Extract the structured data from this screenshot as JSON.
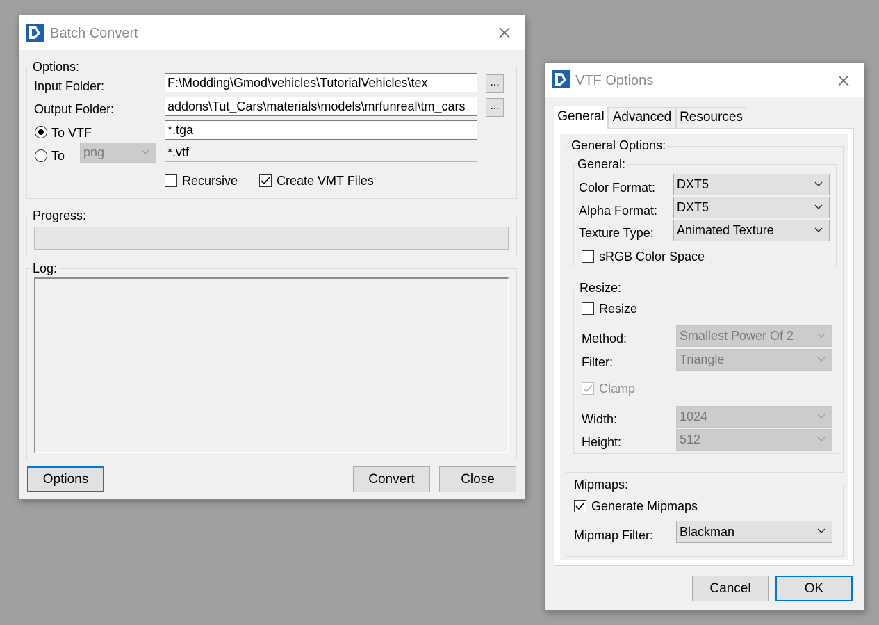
{
  "batch": {
    "title": "Batch Convert",
    "options_group": "Options:",
    "input_label": "Input Folder:",
    "input_value": "F:\\Modding\\Gmod\\vehicles\\TutorialVehicles\\tex",
    "browse_label": "...",
    "output_label": "Output Folder:",
    "output_value": "addons\\Tut_Cars\\materials\\models\\mrfunreal\\tm_cars",
    "to_vtf_label": "To VTF",
    "to_label": "To",
    "to_format": "png",
    "filter_in": "*.tga",
    "filter_out": "*.vtf",
    "recursive_label": "Recursive",
    "recursive_checked": false,
    "create_vmt_label": "Create VMT Files",
    "create_vmt_checked": true,
    "progress_group": "Progress:",
    "progress_value": 0,
    "log_group": "Log:",
    "options_button": "Options",
    "convert_button": "Convert",
    "close_button": "Close"
  },
  "vtf": {
    "title": "VTF Options",
    "tabs": [
      "General",
      "Advanced",
      "Resources"
    ],
    "active_tab": "General",
    "general_options_group": "General Options:",
    "general_group": "General:",
    "color_format_label": "Color Format:",
    "color_format_value": "DXT5",
    "alpha_format_label": "Alpha Format:",
    "alpha_format_value": "DXT5",
    "texture_type_label": "Texture Type:",
    "texture_type_value": "Animated Texture",
    "srgb_label": "sRGB Color Space",
    "srgb_checked": false,
    "resize_group": "Resize:",
    "resize_label": "Resize",
    "resize_checked": false,
    "method_label": "Method:",
    "method_value": "Smallest Power Of 2",
    "filter_label": "Filter:",
    "filter_value": "Triangle",
    "clamp_label": "Clamp",
    "clamp_checked": true,
    "width_label": "Width:",
    "width_value": "1024",
    "height_label": "Height:",
    "height_value": "512",
    "mipmaps_group": "Mipmaps:",
    "generate_mipmaps_label": "Generate Mipmaps",
    "generate_mipmaps_checked": true,
    "mipmap_filter_label": "Mipmap Filter:",
    "mipmap_filter_value": "Blackman",
    "cancel_button": "Cancel",
    "ok_button": "OK"
  },
  "colors": {
    "desktop": "#a0a0a0",
    "window_bg": "#f0f0f0",
    "accent": "#0078d7",
    "title_text": "#8c8c8c"
  }
}
